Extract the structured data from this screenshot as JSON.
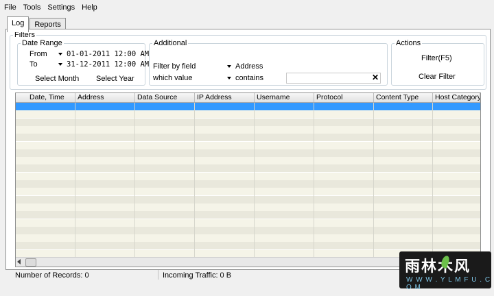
{
  "menu": [
    "File",
    "Tools",
    "Settings",
    "Help"
  ],
  "tabs": [
    {
      "label": "Log",
      "active": true
    },
    {
      "label": "Reports",
      "active": false
    }
  ],
  "filters": {
    "legend": "Filters",
    "date_range": {
      "legend": "Date Range",
      "from_label": "From",
      "from_value": "01-01-2011 12:00 AM",
      "to_label": "To",
      "to_value": "31-12-2011 12:00 AM",
      "select_month": "Select Month",
      "select_year": "Select Year"
    },
    "additional": {
      "legend": "Additional",
      "filter_by_label": "Filter by field",
      "filter_by_value": "Address",
      "which_value_label": "which value",
      "which_value_value": "contains",
      "value_input": "",
      "clear_icon": "x-icon"
    },
    "actions": {
      "legend": "Actions",
      "filter_button": "Filter(F5)",
      "clear_button": "Clear Filter"
    }
  },
  "table": {
    "columns": [
      "Date, Time",
      "Address",
      "Data Source",
      "IP Address",
      "Username",
      "Protocol",
      "Content Type",
      "Host Category"
    ],
    "rows": []
  },
  "status": {
    "records": "Number of Records: 0",
    "traffic": "Incoming Traffic: 0 B"
  },
  "watermark": {
    "main": "雨林木风",
    "url": "W W W . Y L M F U . C O M"
  },
  "colors": {
    "selection": "#3399ff",
    "row_alt": "#f5f4e8",
    "row_norm": "#e9e8dc"
  }
}
